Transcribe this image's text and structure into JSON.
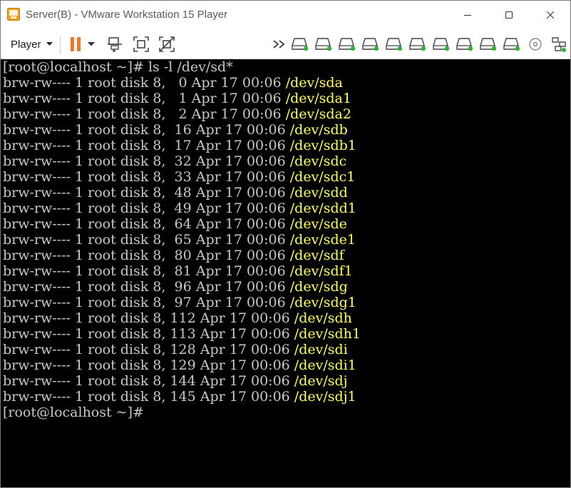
{
  "window": {
    "title": "Server(B) - VMware Workstation 15 Player"
  },
  "toolbar": {
    "player_label": "Player",
    "icons": [
      "pause-icon",
      "dropdown-caret-icon",
      "send-ctrl-alt-del-icon",
      "fit-guest-icon",
      "unity-icon",
      "more-devices-icon",
      "hard-disk-icon",
      "hard-disk-icon",
      "hard-disk-icon",
      "hard-disk-icon",
      "hard-disk-icon",
      "hard-disk-icon",
      "hard-disk-icon",
      "hard-disk-icon",
      "cd-dvd-icon",
      "network-icon"
    ]
  },
  "colors": {
    "device_name": "#ffff55",
    "terminal_text": "#c8c8c8",
    "terminal_bg": "#000000",
    "pause_icon": "#f4762d",
    "disk_activity": "#2bb43a"
  },
  "terminal": {
    "command_line": "[root@localhost ~]# ls -l /dev/sd*",
    "rows": [
      {
        "prefix": "brw-rw---- 1 root disk 8,   0 Apr 17 00:06 ",
        "dev": "/dev/sda"
      },
      {
        "prefix": "brw-rw---- 1 root disk 8,   1 Apr 17 00:06 ",
        "dev": "/dev/sda1"
      },
      {
        "prefix": "brw-rw---- 1 root disk 8,   2 Apr 17 00:06 ",
        "dev": "/dev/sda2"
      },
      {
        "prefix": "brw-rw---- 1 root disk 8,  16 Apr 17 00:06 ",
        "dev": "/dev/sdb"
      },
      {
        "prefix": "brw-rw---- 1 root disk 8,  17 Apr 17 00:06 ",
        "dev": "/dev/sdb1"
      },
      {
        "prefix": "brw-rw---- 1 root disk 8,  32 Apr 17 00:06 ",
        "dev": "/dev/sdc"
      },
      {
        "prefix": "brw-rw---- 1 root disk 8,  33 Apr 17 00:06 ",
        "dev": "/dev/sdc1"
      },
      {
        "prefix": "brw-rw---- 1 root disk 8,  48 Apr 17 00:06 ",
        "dev": "/dev/sdd"
      },
      {
        "prefix": "brw-rw---- 1 root disk 8,  49 Apr 17 00:06 ",
        "dev": "/dev/sdd1"
      },
      {
        "prefix": "brw-rw---- 1 root disk 8,  64 Apr 17 00:06 ",
        "dev": "/dev/sde"
      },
      {
        "prefix": "brw-rw---- 1 root disk 8,  65 Apr 17 00:06 ",
        "dev": "/dev/sde1"
      },
      {
        "prefix": "brw-rw---- 1 root disk 8,  80 Apr 17 00:06 ",
        "dev": "/dev/sdf"
      },
      {
        "prefix": "brw-rw---- 1 root disk 8,  81 Apr 17 00:06 ",
        "dev": "/dev/sdf1"
      },
      {
        "prefix": "brw-rw---- 1 root disk 8,  96 Apr 17 00:06 ",
        "dev": "/dev/sdg"
      },
      {
        "prefix": "brw-rw---- 1 root disk 8,  97 Apr 17 00:06 ",
        "dev": "/dev/sdg1"
      },
      {
        "prefix": "brw-rw---- 1 root disk 8, 112 Apr 17 00:06 ",
        "dev": "/dev/sdh"
      },
      {
        "prefix": "brw-rw---- 1 root disk 8, 113 Apr 17 00:06 ",
        "dev": "/dev/sdh1"
      },
      {
        "prefix": "brw-rw---- 1 root disk 8, 128 Apr 17 00:06 ",
        "dev": "/dev/sdi"
      },
      {
        "prefix": "brw-rw---- 1 root disk 8, 129 Apr 17 00:06 ",
        "dev": "/dev/sdi1"
      },
      {
        "prefix": "brw-rw---- 1 root disk 8, 144 Apr 17 00:06 ",
        "dev": "/dev/sdj"
      },
      {
        "prefix": "brw-rw---- 1 root disk 8, 145 Apr 17 00:06 ",
        "dev": "/dev/sdj1"
      }
    ],
    "prompt_line": "[root@localhost ~]#"
  }
}
